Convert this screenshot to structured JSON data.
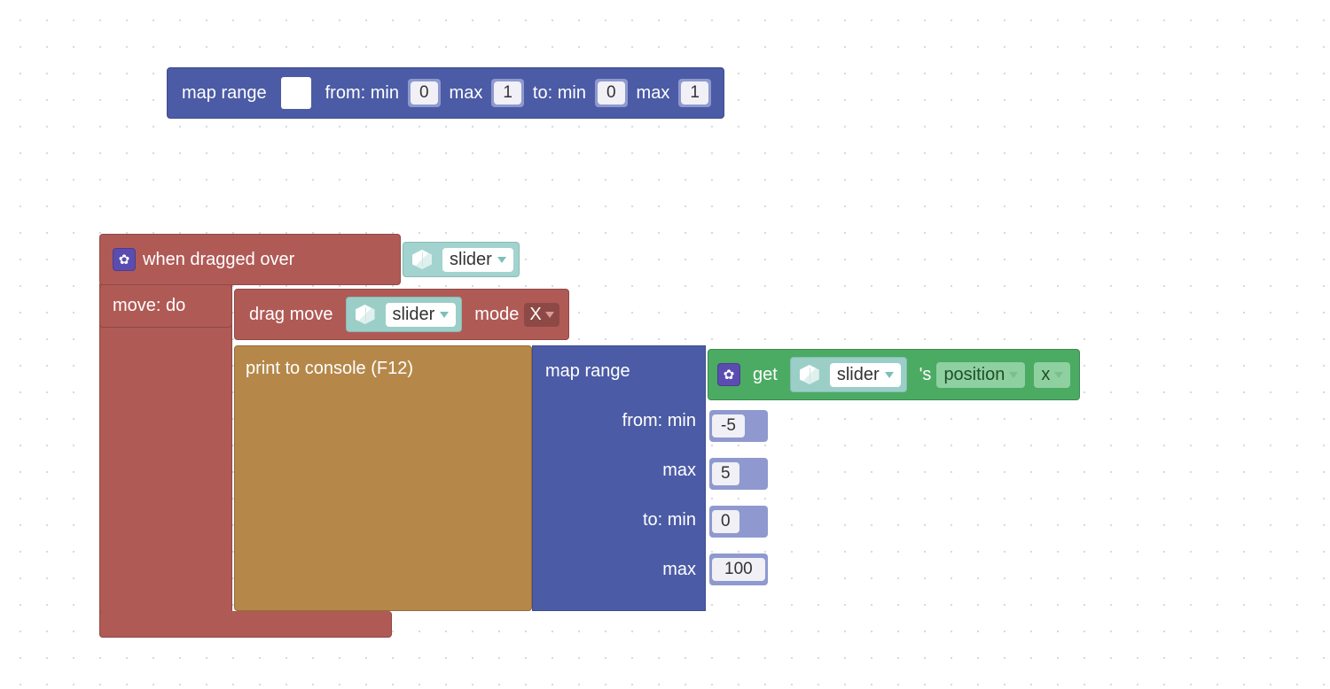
{
  "top_block": {
    "name": "map range",
    "from_min_label": "from: min",
    "from_min": "0",
    "from_max_label": "max",
    "from_max": "1",
    "to_min_label": "to: min",
    "to_min": "0",
    "to_max_label": "max",
    "to_max": "1"
  },
  "hat": {
    "title": "when dragged over",
    "mover_label": "move: do",
    "object": "slider"
  },
  "drag_move": {
    "name": "drag move",
    "object": "slider",
    "mode_label": "mode",
    "mode": "X"
  },
  "print": {
    "name": "print to console (F12)"
  },
  "map2": {
    "name": "map range",
    "from_min_label": "from: min",
    "from_min": "-5",
    "from_max_label": "max",
    "from_max": "5",
    "to_min_label": "to: min",
    "to_min": "0",
    "to_max_label": "max",
    "to_max": "100"
  },
  "getter": {
    "get_label": "get",
    "object": "slider",
    "apos": "'s",
    "prop": "position",
    "axis": "x"
  }
}
